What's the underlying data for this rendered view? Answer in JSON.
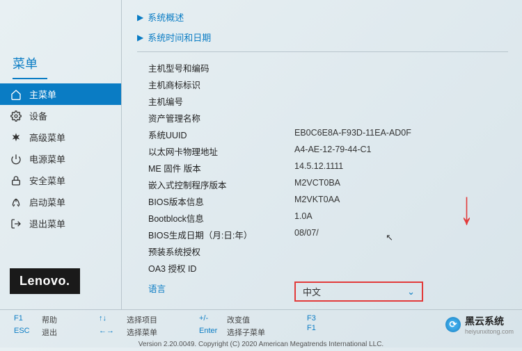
{
  "sidebar": {
    "title": "菜单",
    "items": [
      {
        "label": "主菜单"
      },
      {
        "label": "设备"
      },
      {
        "label": "高级菜单"
      },
      {
        "label": "电源菜单"
      },
      {
        "label": "安全菜单"
      },
      {
        "label": "启动菜单"
      },
      {
        "label": "退出菜单"
      }
    ]
  },
  "logo": "Lenovo.",
  "sections": {
    "overview": "系统概述",
    "datetime": "系统时间和日期"
  },
  "info": [
    {
      "label": "主机型号和编码",
      "value": ""
    },
    {
      "label": "主机商标标识",
      "value": ""
    },
    {
      "label": "主机编号",
      "value": ""
    },
    {
      "label": "资产管理名称",
      "value": ""
    },
    {
      "label": "系统UUID",
      "value": "EB0C6E8A-F93D-11EA-AD0F"
    },
    {
      "label": "以太网卡物理地址",
      "value": "A4-AE-12-79-44-C1"
    },
    {
      "label": "ME 固件 版本",
      "value": "14.5.12.1111"
    },
    {
      "label": "嵌入式控制程序版本",
      "value": "M2VCT0BA"
    },
    {
      "label": "BIOS版本信息",
      "value": "M2VKT0AA"
    },
    {
      "label": "Bootblock信息",
      "value": "1.0A"
    },
    {
      "label": "BIOS生成日期（月:日:年）",
      "value": "08/07/"
    },
    {
      "label": "预装系统授权",
      "value": ""
    },
    {
      "label": "OA3 授权 ID",
      "value": ""
    }
  ],
  "language": {
    "label": "语言",
    "value": "中文"
  },
  "footer": {
    "f1": "帮助",
    "esc": "退出",
    "updown": "选择项目",
    "leftright": "选择菜单",
    "plusminus": "改变值",
    "enter": "选择子菜单",
    "copyright": "Version 2.20.0049. Copyright (C) 2020 American Megatrends International LLC."
  },
  "watermark": {
    "title": "黑云系统",
    "sub": "heiyunxitong.com"
  }
}
